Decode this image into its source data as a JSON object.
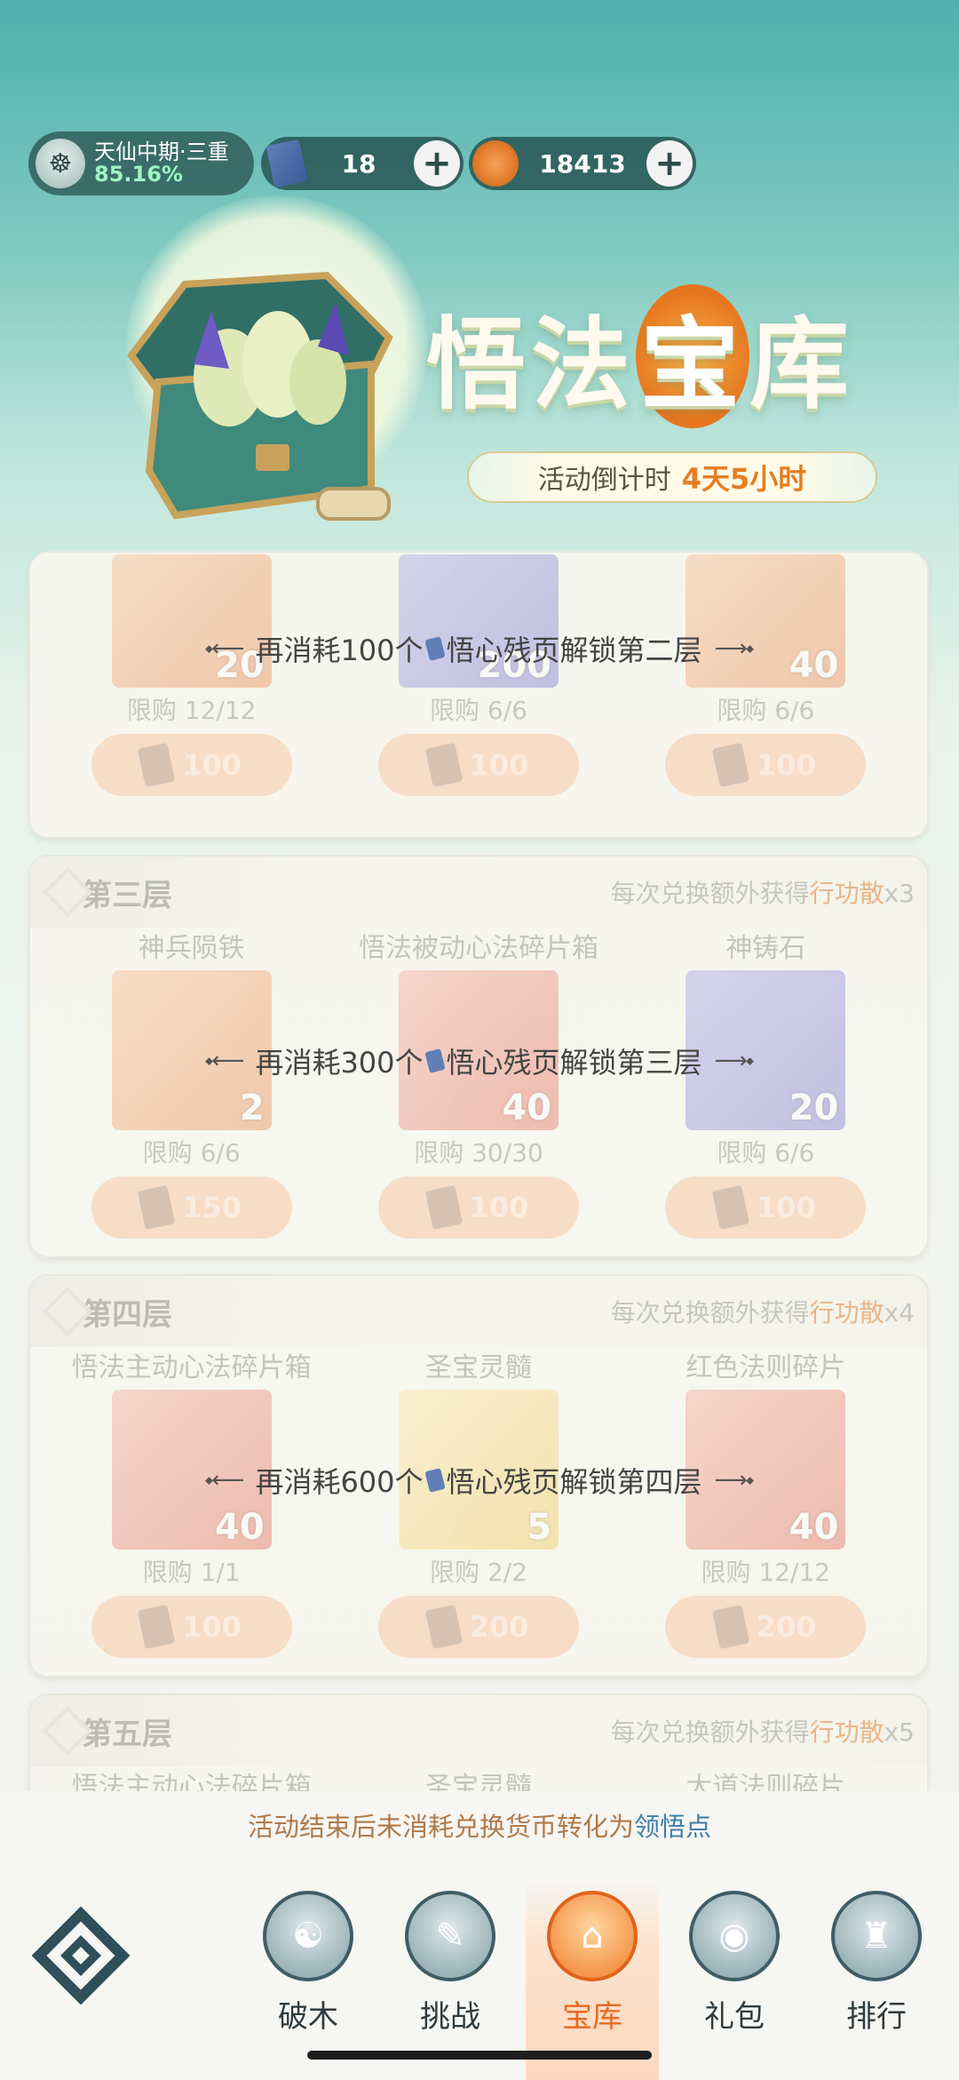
{
  "header": {
    "realm_name": "天仙中期·三重",
    "realm_progress": "85.16%",
    "jade_icon": "scroll-page-icon",
    "jade_count": "18",
    "coin_icon": "spirit-coin-icon",
    "coin_count": "18413",
    "plus": "+"
  },
  "banner": {
    "title_pre": "悟法",
    "title_bao": "宝",
    "title_post": "库",
    "countdown_label": "活动倒计时",
    "countdown_value": "4天5小时"
  },
  "colors": {
    "accent_orange": "#e67e22",
    "link_blue": "#3d7fa8",
    "teal_header": "#4fb0ae"
  },
  "tiers": [
    {
      "lock_text_a": "再消耗100个",
      "lock_text_b": "悟心残页解锁第二层",
      "items": [
        {
          "count": "20",
          "limit": "限购 12/12",
          "price": "100"
        },
        {
          "count": "200",
          "limit": "限购 6/6",
          "price": "100"
        },
        {
          "count": "40",
          "limit": "限购 6/6",
          "price": "100"
        }
      ]
    },
    {
      "name": "第三层",
      "bonus_pre": "每次兑换额外获得",
      "bonus_item": "行功散",
      "bonus_mult": "x3",
      "lock_text_a": "再消耗300个",
      "lock_text_b": "悟心残页解锁第三层",
      "items": [
        {
          "name": "神兵陨铁",
          "count": "2",
          "limit": "限购 6/6",
          "price": "150"
        },
        {
          "name": "悟法被动心法碎片箱",
          "count": "40",
          "limit": "限购 30/30",
          "price": "100"
        },
        {
          "name": "神铸石",
          "count": "20",
          "limit": "限购 6/6",
          "price": "100"
        }
      ]
    },
    {
      "name": "第四层",
      "bonus_pre": "每次兑换额外获得",
      "bonus_item": "行功散",
      "bonus_mult": "x4",
      "lock_text_a": "再消耗600个",
      "lock_text_b": "悟心残页解锁第四层",
      "items": [
        {
          "name": "悟法主动心法碎片箱",
          "count": "40",
          "limit": "限购 1/1",
          "price": "100"
        },
        {
          "name": "圣宝灵髓",
          "count": "5",
          "limit": "限购 2/2",
          "price": "200"
        },
        {
          "name": "红色法则碎片",
          "count": "40",
          "limit": "限购 12/12",
          "price": "200"
        }
      ]
    },
    {
      "name": "第五层",
      "bonus_pre": "每次兑换额外获得",
      "bonus_item": "行功散",
      "bonus_mult": "x5",
      "items": [
        {
          "name": "悟法主动心法碎片箱"
        },
        {
          "name": "圣宝灵髓"
        },
        {
          "name": "大道法则碎片"
        }
      ]
    }
  ],
  "notice": {
    "text_pre": "活动结束后未消耗兑换货币转化为",
    "text_hl": "领悟点"
  },
  "tabs": [
    {
      "label": "破木",
      "icon": "warrior-icon"
    },
    {
      "label": "挑战",
      "icon": "scroll-icon"
    },
    {
      "label": "宝库",
      "icon": "treasury-icon"
    },
    {
      "label": "礼包",
      "icon": "gift-icon"
    },
    {
      "label": "排行",
      "icon": "ranking-icon"
    }
  ]
}
